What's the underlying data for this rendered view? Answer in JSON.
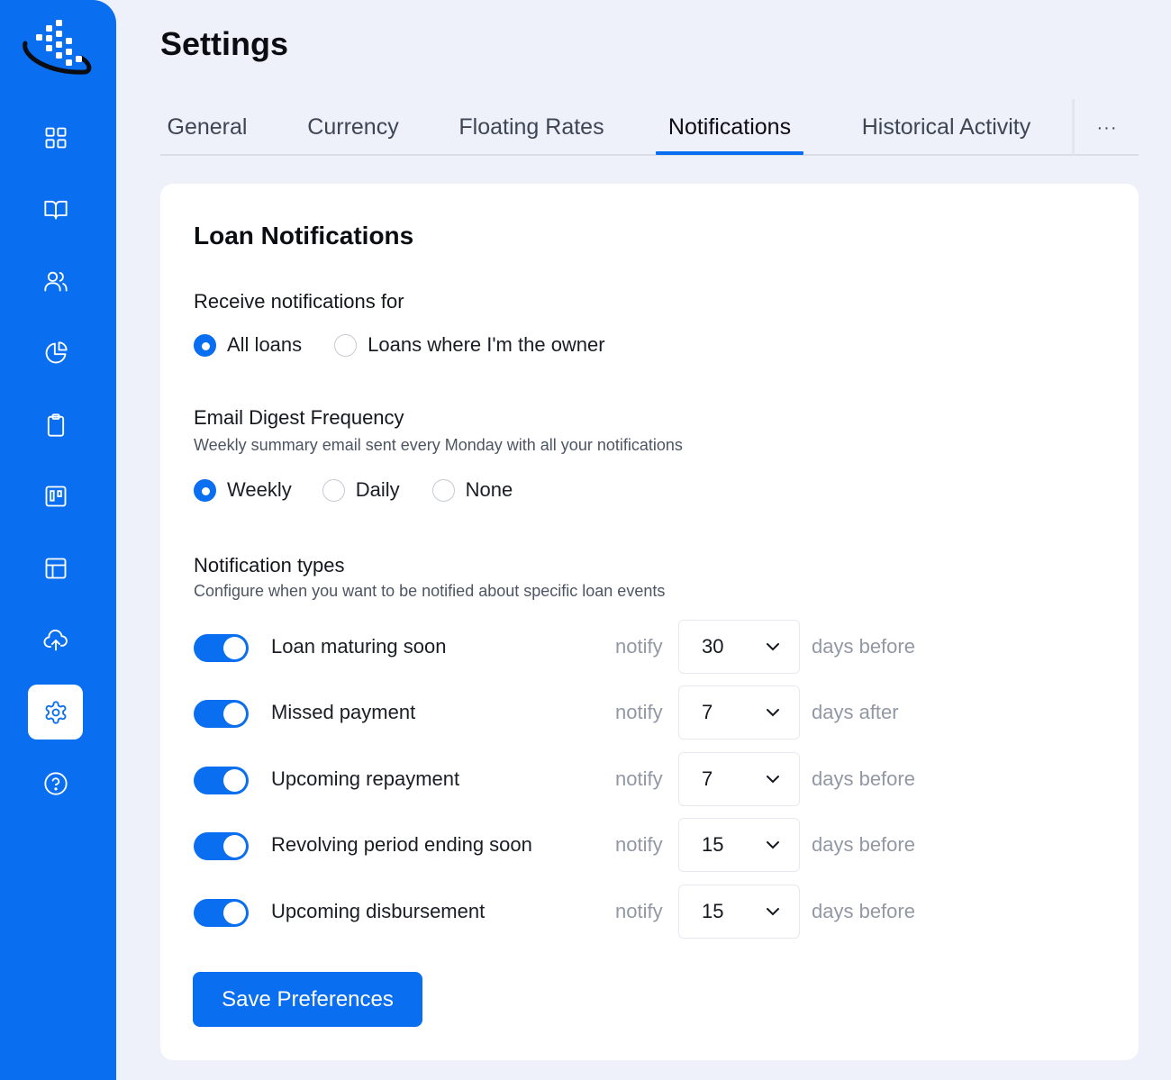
{
  "page": {
    "title": "Settings"
  },
  "tabs": {
    "items": [
      {
        "label": "General"
      },
      {
        "label": "Currency"
      },
      {
        "label": "Floating Rates"
      },
      {
        "label": "Notifications"
      },
      {
        "label": "Historical Activity"
      }
    ],
    "active": "Notifications",
    "more_label": "···"
  },
  "sidebar": {
    "icons": [
      "dashboard-icon",
      "book-icon",
      "users-icon",
      "pie-chart-icon",
      "clipboard-icon",
      "kanban-icon",
      "table-icon",
      "cloud-upload-icon",
      "gear-icon",
      "help-icon"
    ],
    "active": "gear-icon"
  },
  "card": {
    "title": "Loan Notifications",
    "receive": {
      "label": "Receive notifications for",
      "options": [
        "All loans",
        "Loans where I'm the owner"
      ],
      "selected": "All loans"
    },
    "digest": {
      "label": "Email Digest Frequency",
      "description": "Weekly summary email sent every Monday with all your notifications",
      "options": [
        "Weekly",
        "Daily",
        "None"
      ],
      "selected": "Weekly"
    },
    "types": {
      "label": "Notification types",
      "description": "Configure when you want to be notified about specific loan events",
      "notify_label": "notify",
      "rows": [
        {
          "label": "Loan maturing soon",
          "enabled": true,
          "value": "30",
          "suffix": "days before"
        },
        {
          "label": "Missed payment",
          "enabled": true,
          "value": "7",
          "suffix": "days after"
        },
        {
          "label": "Upcoming repayment",
          "enabled": true,
          "value": "7",
          "suffix": "days before"
        },
        {
          "label": "Revolving period ending soon",
          "enabled": true,
          "value": "15",
          "suffix": "days before"
        },
        {
          "label": "Upcoming disbursement",
          "enabled": true,
          "value": "15",
          "suffix": "days before"
        }
      ]
    },
    "save_label": "Save Preferences"
  },
  "colors": {
    "accent": "#0a6ef0",
    "background": "#eef1f9",
    "card": "#ffffff"
  }
}
